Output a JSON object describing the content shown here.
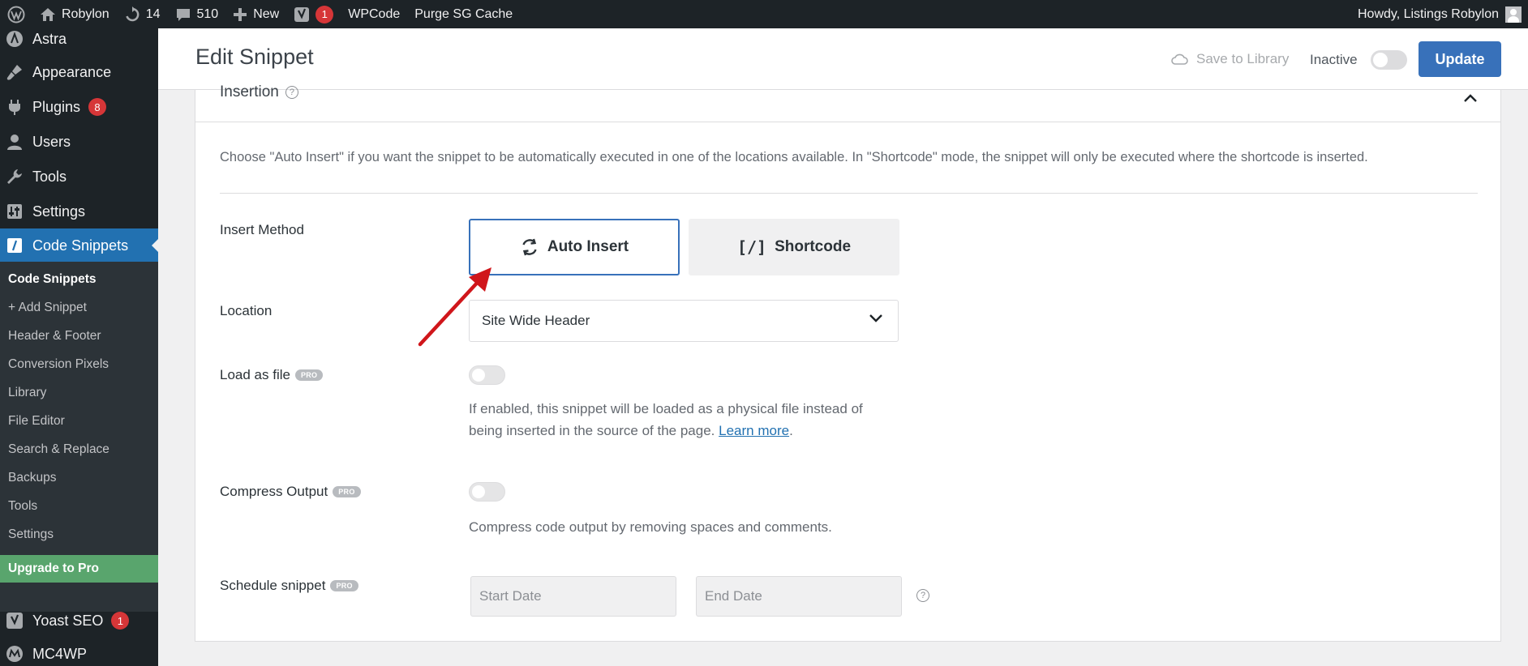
{
  "adminbar": {
    "site_name": "Robylon",
    "updates_count": "14",
    "comments_count": "510",
    "new_label": "New",
    "yoast_badge": "1",
    "wpcode_label": "WPCode",
    "purge_label": "Purge SG Cache",
    "howdy": "Howdy, Listings Robylon"
  },
  "sidebar": {
    "items": [
      {
        "label": "Astra",
        "icon": "astra-icon"
      },
      {
        "label": "Appearance",
        "icon": "paintbrush-icon"
      },
      {
        "label": "Plugins",
        "icon": "plugin-icon",
        "badge": "8"
      },
      {
        "label": "Users",
        "icon": "users-icon"
      },
      {
        "label": "Tools",
        "icon": "wrench-icon"
      },
      {
        "label": "Settings",
        "icon": "settings-icon"
      },
      {
        "label": "Code Snippets",
        "icon": "code-snippets-icon",
        "current": true
      }
    ],
    "submenu": [
      "Code Snippets",
      "+ Add Snippet",
      "Header & Footer",
      "Conversion Pixels",
      "Library",
      "File Editor",
      "Search & Replace",
      "Backups",
      "Tools",
      "Settings"
    ],
    "upgrade": "Upgrade to Pro",
    "bottom_items": [
      {
        "label": "Yoast SEO",
        "icon": "yoast-icon",
        "badge": "1"
      },
      {
        "label": "MC4WP",
        "icon": "mc4wp-icon"
      }
    ]
  },
  "header": {
    "title": "Edit Snippet",
    "save_library": "Save to Library",
    "status_label": "Inactive",
    "update_button": "Update"
  },
  "panel": {
    "title": "Insertion",
    "description": "Choose \"Auto Insert\" if you want the snippet to be automatically executed in one of the locations available. In \"Shortcode\" mode, the snippet will only be executed where the shortcode is inserted.",
    "insert_method": {
      "label": "Insert Method",
      "auto_insert": "Auto Insert",
      "shortcode": "Shortcode",
      "shortcode_glyph": "[/]"
    },
    "location": {
      "label": "Location",
      "value": "Site Wide Header"
    },
    "load_as_file": {
      "label": "Load as file",
      "badge": "PRO",
      "help_line1": "If enabled, this snippet will be loaded as a physical file instead of",
      "help_line2": "being inserted in the source of the page.",
      "learn_more": "Learn more",
      "period": "."
    },
    "compress_output": {
      "label": "Compress Output",
      "badge": "PRO",
      "help": "Compress code output by removing spaces and comments."
    },
    "schedule": {
      "label": "Schedule snippet",
      "badge": "PRO",
      "start_placeholder": "Start Date",
      "end_placeholder": "End Date"
    }
  },
  "colors": {
    "accent": "#3871ba",
    "admin_dark": "#1d2327",
    "current_menu": "#2271b1",
    "upgrade_green": "#59a56d",
    "badge_red": "#d63638",
    "annotation_arrow": "#d0161b"
  }
}
